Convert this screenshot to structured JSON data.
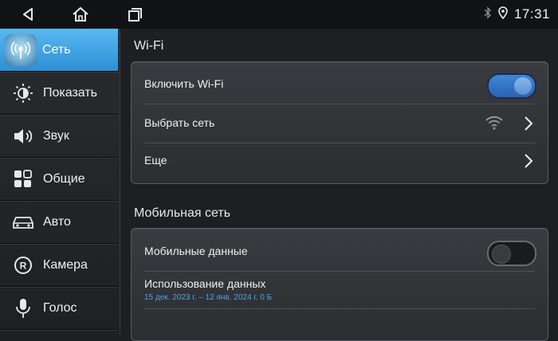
{
  "status_bar": {
    "time": "17:31",
    "back_icon": "back-triangle-icon",
    "home_icon": "home-icon",
    "recents_icon": "recents-icon",
    "bluetooth_icon": "bluetooth-icon",
    "location_icon": "location-icon"
  },
  "sidebar": {
    "items": [
      {
        "label": "Сеть",
        "icon": "network-icon",
        "active": true
      },
      {
        "label": "Показать",
        "icon": "brightness-icon",
        "active": false
      },
      {
        "label": "Звук",
        "icon": "speaker-icon",
        "active": false
      },
      {
        "label": "Общие",
        "icon": "grid-icon",
        "active": false
      },
      {
        "label": "Авто",
        "icon": "car-icon",
        "active": false
      },
      {
        "label": "Камера",
        "icon": "camera-r-icon",
        "active": false
      },
      {
        "label": "Голос",
        "icon": "microphone-icon",
        "active": false
      }
    ]
  },
  "wifi_section": {
    "title": "Wi-Fi",
    "enable_label": "Включить Wi-Fi",
    "enable_state": "on",
    "choose_network_label": "Выбрать сеть",
    "more_label": "Еще"
  },
  "mobile_section": {
    "title": "Мобильная сеть",
    "mobile_data_label": "Мобильные данные",
    "mobile_data_state": "off",
    "data_usage_label": "Использование данных",
    "data_usage_detail": "15 дек. 2023 г. – 12 янв. 2024 г. 0 Б"
  },
  "colors": {
    "accent": "#3a95dd",
    "sidebar_active": "#3c9de0",
    "toggle_on": "#3f86d8",
    "link_text": "#48a6e8"
  }
}
